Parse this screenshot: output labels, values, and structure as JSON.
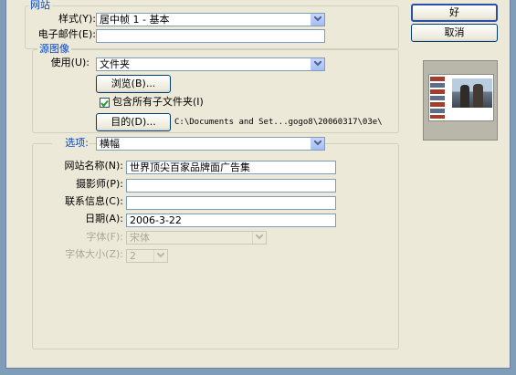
{
  "site": {
    "group_label": "网站",
    "style_label": "样式(Y):",
    "style_value": "居中帧 1 - 基本",
    "email_label": "电子邮件(E):",
    "email_value": ""
  },
  "source": {
    "group_label": "源图像",
    "use_label": "使用(U):",
    "use_value": "文件夹",
    "browse_label": "浏览(B)...",
    "include_subfolders_label": "包含所有子文件夹(I)",
    "include_subfolders_checked": true,
    "destination_label": "目的(D)...",
    "destination_path": "C:\\Documents and Set...gogo8\\20060317\\03e\\"
  },
  "options": {
    "label": "选项:",
    "value": "横幅",
    "site_name_label": "网站名称(N):",
    "site_name_value": "世界顶尖百家品牌面广告集",
    "photographer_label": "摄影师(P):",
    "photographer_value": "",
    "contact_label": "联系信息(C):",
    "contact_value": "",
    "date_label": "日期(A):",
    "date_value": "2006-3-22",
    "font_label": "字体(F):",
    "font_value": "宋体",
    "font_size_label": "字体大小(Z):",
    "font_size_value": "2"
  },
  "buttons": {
    "ok": "好",
    "cancel": "取消"
  },
  "colors": {
    "dialog_bg": "#ece9d8",
    "group_title": "#0046d5",
    "field_border": "#7f9db9"
  }
}
